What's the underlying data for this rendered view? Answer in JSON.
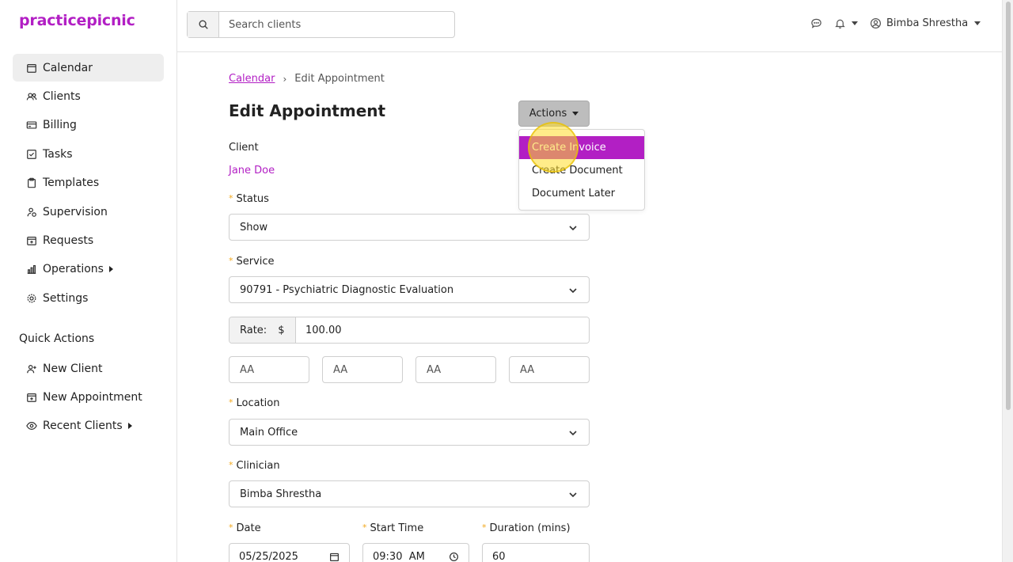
{
  "app": {
    "logo": "practicepicnic",
    "brand_color": "#b21fc4",
    "accent_required_color": "#f2a81d"
  },
  "sidebar": {
    "items": [
      {
        "label": "Calendar",
        "icon": "calendar-icon",
        "active": true
      },
      {
        "label": "Clients",
        "icon": "users-icon"
      },
      {
        "label": "Billing",
        "icon": "credit-card-icon"
      },
      {
        "label": "Tasks",
        "icon": "checkbox-icon"
      },
      {
        "label": "Templates",
        "icon": "clipboard-icon"
      },
      {
        "label": "Supervision",
        "icon": "user-supervision-icon"
      },
      {
        "label": "Requests",
        "icon": "calendar-plus-icon"
      },
      {
        "label": "Operations",
        "icon": "bar-chart-icon",
        "expandable": true
      },
      {
        "label": "Settings",
        "icon": "gear-icon"
      }
    ],
    "quick_actions_title": "Quick Actions",
    "quick_actions": [
      {
        "label": "New Client",
        "icon": "user-plus-icon"
      },
      {
        "label": "New Appointment",
        "icon": "calendar-plus-icon"
      },
      {
        "label": "Recent Clients",
        "icon": "eye-icon",
        "expandable": true
      }
    ]
  },
  "topbar": {
    "search_placeholder": "Search clients",
    "user_name": "Bimba Shrestha"
  },
  "breadcrumb": {
    "parent": "Calendar",
    "separator": "›",
    "current": "Edit Appointment"
  },
  "page": {
    "title": "Edit Appointment"
  },
  "actions": {
    "label": "Actions",
    "menu": [
      "Create Invoice",
      "Create Document",
      "Document Later"
    ],
    "highlighted_index": 0
  },
  "form": {
    "client_label": "Client",
    "client_name": "Jane Doe",
    "status_label": "Status",
    "status_value": "Show",
    "service_label": "Service",
    "service_value": "90791 - Psychiatric Diagnostic Evaluation",
    "rate_label": "Rate:",
    "rate_currency": "$",
    "rate_value": "100.00",
    "modifiers_placeholder": [
      "AA",
      "AA",
      "AA",
      "AA"
    ],
    "location_label": "Location",
    "location_value": "Main Office",
    "clinician_label": "Clinician",
    "clinician_value": "Bimba Shrestha",
    "date_label": "Date",
    "date_value": "05/25/2025",
    "start_time_label": "Start Time",
    "start_time_value": "09:30  AM",
    "duration_label": "Duration (mins)",
    "duration_value": "60",
    "required_marker": "*"
  }
}
